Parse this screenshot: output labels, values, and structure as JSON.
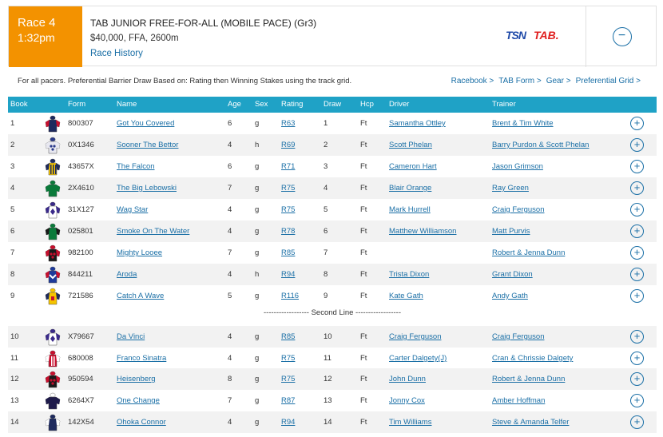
{
  "race": {
    "number_label": "Race 4",
    "time": "1:32pm",
    "title": "TAB JUNIOR FREE-FOR-ALL (MOBILE PACE) (Gr3)",
    "details": "$40,000, FFA, 2600m",
    "history_link": "Race History",
    "logos": {
      "tsn": "TSN",
      "tab": "TAB."
    },
    "collapse_symbol": "−"
  },
  "notes": {
    "text": "For all pacers. Preferential Barrier Draw Based on: Rating then Winning Stakes using the track grid.",
    "links": [
      "Racebook >",
      "TAB Form >",
      "Gear >",
      "Preferential Grid >"
    ]
  },
  "columns": [
    "Book",
    "Form",
    "Name",
    "Age",
    "Sex",
    "Rating",
    "Draw",
    "Hcp",
    "Driver",
    "Trainer"
  ],
  "divider_label": "------------------ Second Line ------------------",
  "add_symbol": "+",
  "rows": [
    {
      "book": "1",
      "form": "800307",
      "name": "Got You Covered",
      "age": "6",
      "sex": "g",
      "rating": "R63",
      "draw": "1",
      "hcp": "Ft",
      "driver": "Samantha Ottley",
      "driver_link": true,
      "trainer": "Brent & Tim White",
      "silk": {
        "body": "#1e2a5e",
        "sleeve": "#c8102e",
        "pattern": "plain",
        "cap": "#1e2a5e"
      }
    },
    {
      "book": "2",
      "form": "0X1346",
      "name": "Sooner The Bettor",
      "age": "4",
      "sex": "h",
      "rating": "R69",
      "draw": "2",
      "hcp": "Ft",
      "driver": "Scott Phelan",
      "driver_link": false,
      "trainer": "Barry Purdon & Scott Phelan",
      "silk": {
        "body": "#e8e8f0",
        "sleeve": "#e8e8f0",
        "pattern": "spots",
        "cap": "#2a3a8a"
      }
    },
    {
      "book": "3",
      "form": "43657X",
      "name": "The Falcon",
      "age": "6",
      "sex": "g",
      "rating": "R71",
      "draw": "3",
      "hcp": "Ft",
      "driver": "Cameron Hart",
      "driver_link": false,
      "trainer": "Jason Grimson",
      "silk": {
        "body": "#f5c400",
        "sleeve": "#1e2a5e",
        "pattern": "stripes",
        "cap": "#1e2a5e"
      }
    },
    {
      "book": "4",
      "form": "2X4610",
      "name": "The Big Lebowski",
      "age": "7",
      "sex": "g",
      "rating": "R75",
      "draw": "4",
      "hcp": "Ft",
      "driver": "Blair Orange",
      "driver_link": false,
      "trainer": "Ray Green",
      "silk": {
        "body": "#0a7a3a",
        "sleeve": "#0a7a3a",
        "pattern": "plain",
        "cap": "#0a7a3a"
      }
    },
    {
      "book": "5",
      "form": "31X127",
      "name": "Wag Star",
      "age": "4",
      "sex": "g",
      "rating": "R75",
      "draw": "5",
      "hcp": "Ft",
      "driver": "Mark Hurrell",
      "driver_link": false,
      "trainer": "Craig Ferguson",
      "silk": {
        "body": "#ffffff",
        "sleeve": "#3a2a8a",
        "pattern": "diamond",
        "cap": "#3a2a8a"
      }
    },
    {
      "book": "6",
      "form": "025801",
      "name": "Smoke On The Water",
      "age": "4",
      "sex": "g",
      "rating": "R78",
      "draw": "6",
      "hcp": "Ft",
      "driver": "Matthew Williamson",
      "driver_link": false,
      "trainer": "Matt Purvis",
      "silk": {
        "body": "#0a7a3a",
        "sleeve": "#1a1a1a",
        "pattern": "plain",
        "cap": "#0a7a3a"
      }
    },
    {
      "book": "7",
      "form": "982100",
      "name": "Mighty Looee",
      "age": "7",
      "sex": "g",
      "rating": "R85",
      "draw": "7",
      "hcp": "Ft",
      "driver": "",
      "driver_link": false,
      "trainer": "Robert & Jenna Dunn",
      "silk": {
        "body": "#1a1a1a",
        "sleeve": "#c8102e",
        "pattern": "spots-red",
        "cap": "#c8102e"
      }
    },
    {
      "book": "8",
      "form": "844211",
      "name": "Aroda",
      "age": "4",
      "sex": "h",
      "rating": "R94",
      "draw": "8",
      "hcp": "Ft",
      "driver": "Trista Dixon",
      "driver_link": false,
      "trainer": "Grant Dixon",
      "silk": {
        "body": "#1e3a9a",
        "sleeve": "#c8102e",
        "pattern": "chevron",
        "cap": "#1e3a9a"
      }
    },
    {
      "book": "9",
      "form": "721586",
      "name": "Catch A Wave",
      "age": "5",
      "sex": "g",
      "rating": "R116",
      "draw": "9",
      "hcp": "Ft",
      "driver": "Kate Gath",
      "driver_link": false,
      "trainer": "Andy Gath",
      "silk": {
        "body": "#f5c400",
        "sleeve": "#1e2a5e",
        "pattern": "letter",
        "cap": "#f5c400"
      }
    },
    {
      "book": "10",
      "form": "X79667",
      "name": "Da Vinci",
      "age": "4",
      "sex": "g",
      "rating": "R85",
      "draw": "10",
      "hcp": "Ft",
      "driver": "Craig Ferguson",
      "driver_link": false,
      "trainer": "Craig Ferguson",
      "silk": {
        "body": "#ffffff",
        "sleeve": "#3a2a8a",
        "pattern": "diamond",
        "cap": "#3a2a8a"
      }
    },
    {
      "book": "11",
      "form": "680008",
      "name": "Franco Sinatra",
      "age": "4",
      "sex": "g",
      "rating": "R75",
      "draw": "11",
      "hcp": "Ft",
      "driver": "Carter Dalgety(J)",
      "driver_link": false,
      "trainer": "Cran & Chrissie Dalgety",
      "silk": {
        "body": "#c8102e",
        "sleeve": "#ffffff",
        "pattern": "stripes-red",
        "cap": "#c8102e"
      }
    },
    {
      "book": "12",
      "form": "950594",
      "name": "Heisenberg",
      "age": "8",
      "sex": "g",
      "rating": "R75",
      "draw": "12",
      "hcp": "Ft",
      "driver": "John Dunn",
      "driver_link": false,
      "trainer": "Robert & Jenna Dunn",
      "silk": {
        "body": "#1a1a1a",
        "sleeve": "#c8102e",
        "pattern": "spots-red",
        "cap": "#c8102e"
      }
    },
    {
      "book": "13",
      "form": "6264X7",
      "name": "One Change",
      "age": "7",
      "sex": "g",
      "rating": "R87",
      "draw": "13",
      "hcp": "Ft",
      "driver": "Jonny Cox",
      "driver_link": false,
      "trainer": "Amber Hoffman",
      "silk": {
        "body": "#1e1a4a",
        "sleeve": "#1e1a4a",
        "pattern": "plain",
        "cap": "#ffffff"
      }
    },
    {
      "book": "14",
      "form": "142X54",
      "name": "Ohoka Connor",
      "age": "4",
      "sex": "g",
      "rating": "R94",
      "draw": "14",
      "hcp": "Ft",
      "driver": "Tim Williams",
      "driver_link": false,
      "trainer": "Steve & Amanda Telfer",
      "silk": {
        "body": "#1e2a5e",
        "sleeve": "#ffffff",
        "pattern": "check",
        "cap": "#1e2a5e"
      }
    }
  ]
}
